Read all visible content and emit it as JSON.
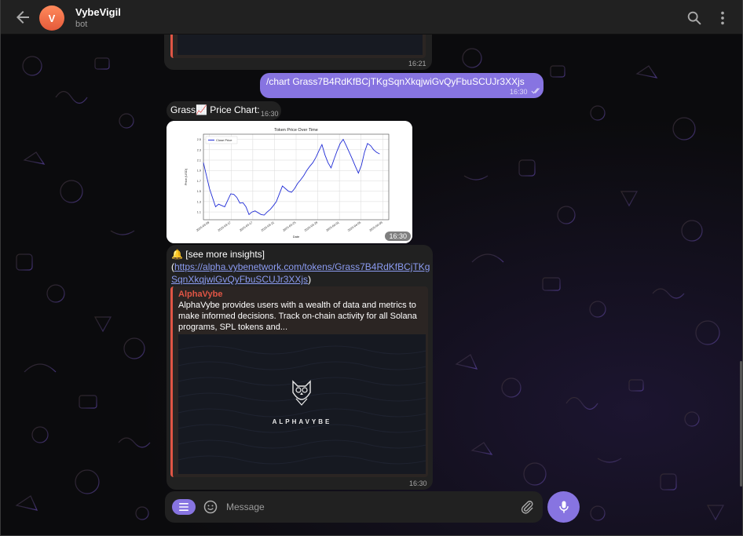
{
  "header": {
    "title": "VybeVigil",
    "subtitle": "bot",
    "avatar_letter": "V",
    "avatar_color": "#e55a3a",
    "back_icon": "arrow-left-icon",
    "search_icon": "search-icon",
    "more_icon": "kebab-menu-icon"
  },
  "messages": {
    "previous_preview": {
      "time": "16:21"
    },
    "outgoing": {
      "text": "/chart Grass7B4RdKfBCjTKgSqnXkqjwiGvQyFbuSCUJr3XXjs",
      "time": "16:30",
      "status_icon": "double-check-icon"
    },
    "grass_label": {
      "text": "Grass📈 Price Chart:",
      "time": "16:30"
    },
    "chart_image": {
      "time": "16:30"
    },
    "insight": {
      "prefix": "🔔 [see more insights]",
      "open_paren": "(",
      "link_text": "https://alpha.vybenetwork.com/tokens/Grass7B4RdKfBCjTKgSqnXkqjwiGvQyFbuSCUJr3XXjs",
      "close_paren": ")",
      "time": "16:30",
      "preview": {
        "site_name": "AlphaVybe",
        "description": "AlphaVybe provides users with a wealth of data and metrics to make informed decisions. Track on-chain activity for all Solana programs, SPL tokens and...",
        "brand": "ALPHAVYBE"
      }
    }
  },
  "composer": {
    "placeholder": "Message",
    "menu_icon": "menu-icon",
    "emoji_icon": "emoji-icon",
    "attach_icon": "paperclip-icon",
    "mic_icon": "microphone-icon"
  },
  "colors": {
    "accent": "#8774e1",
    "bubble_in": "#212121",
    "link": "#8c9cf2",
    "preview_accent": "#e05545"
  },
  "chart_data": {
    "type": "line",
    "title": "Token Price Over Time",
    "xlabel": "Date",
    "ylabel": "Price (USD)",
    "legend": [
      "Close Price"
    ],
    "legend_position": "top-left",
    "grid": true,
    "ylim": [
      0.95,
      2.6
    ],
    "yticks": [
      1.1,
      1.3,
      1.5,
      1.7,
      1.9,
      2.1,
      2.3,
      2.5
    ],
    "xticks": [
      "2025-03-09",
      "2025-03-17",
      "2025-03-17",
      "2025-03-21",
      "2025-03-25",
      "2025-03-29",
      "2025-04-01",
      "2025-04-05",
      "2025-04-09"
    ],
    "x_range": [
      0,
      61
    ],
    "series": [
      {
        "name": "Close Price",
        "color": "#1f2bd6",
        "x": [
          0,
          2,
          4,
          5,
          7,
          9,
          10,
          11,
          12,
          13,
          14,
          15,
          16,
          17,
          19,
          20,
          21,
          22,
          23,
          24,
          25,
          26,
          27,
          28,
          29,
          30,
          31,
          32,
          33,
          34,
          35,
          36,
          37,
          38,
          39,
          40,
          41,
          42,
          43,
          44,
          45,
          46,
          47,
          48,
          49,
          50,
          51,
          52,
          53,
          54,
          55,
          56,
          57,
          58
        ],
        "values": [
          2.05,
          1.55,
          1.2,
          1.25,
          1.2,
          1.45,
          1.44,
          1.38,
          1.27,
          1.28,
          1.2,
          1.05,
          1.1,
          1.12,
          1.05,
          1.04,
          1.1,
          1.15,
          1.22,
          1.3,
          1.45,
          1.6,
          1.55,
          1.5,
          1.48,
          1.55,
          1.65,
          1.72,
          1.8,
          1.9,
          1.98,
          2.05,
          2.15,
          2.28,
          2.4,
          2.2,
          2.05,
          1.95,
          2.12,
          2.28,
          2.42,
          2.5,
          2.38,
          2.25,
          2.12,
          1.98,
          1.85,
          2.0,
          2.25,
          2.42,
          2.38,
          2.3,
          2.25,
          2.22
        ]
      }
    ]
  }
}
